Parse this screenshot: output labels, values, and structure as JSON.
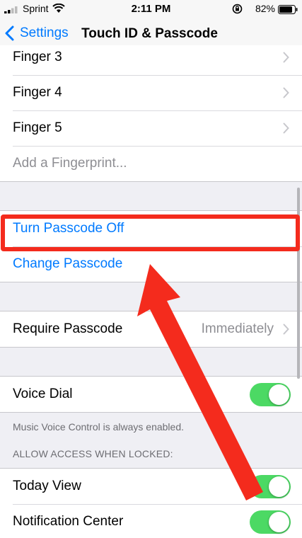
{
  "status_bar": {
    "carrier": "Sprint",
    "time": "2:11 PM",
    "battery": "82%",
    "icons": [
      "signal-icon",
      "wifi-icon",
      "rotation-lock-icon",
      "battery-icon"
    ]
  },
  "nav": {
    "back_label": "Settings",
    "title": "Touch ID & Passcode"
  },
  "fingerprints": {
    "items": [
      {
        "label": "Finger 3"
      },
      {
        "label": "Finger 4"
      },
      {
        "label": "Finger 5"
      }
    ],
    "add_label": "Add a Fingerprint..."
  },
  "passcode": {
    "turn_off_label": "Turn Passcode Off",
    "change_label": "Change Passcode"
  },
  "require_passcode": {
    "label": "Require Passcode",
    "value": "Immediately"
  },
  "voice_dial": {
    "label": "Voice Dial",
    "enabled": true,
    "footer": "Music Voice Control is always enabled."
  },
  "locked_access": {
    "header": "ALLOW ACCESS WHEN LOCKED:",
    "items": [
      {
        "label": "Today View",
        "enabled": true
      },
      {
        "label": "Notification Center",
        "enabled": true
      }
    ]
  },
  "colors": {
    "accent": "#007aff",
    "toggle_on": "#4cd964",
    "annotation": "#f42b1d"
  }
}
